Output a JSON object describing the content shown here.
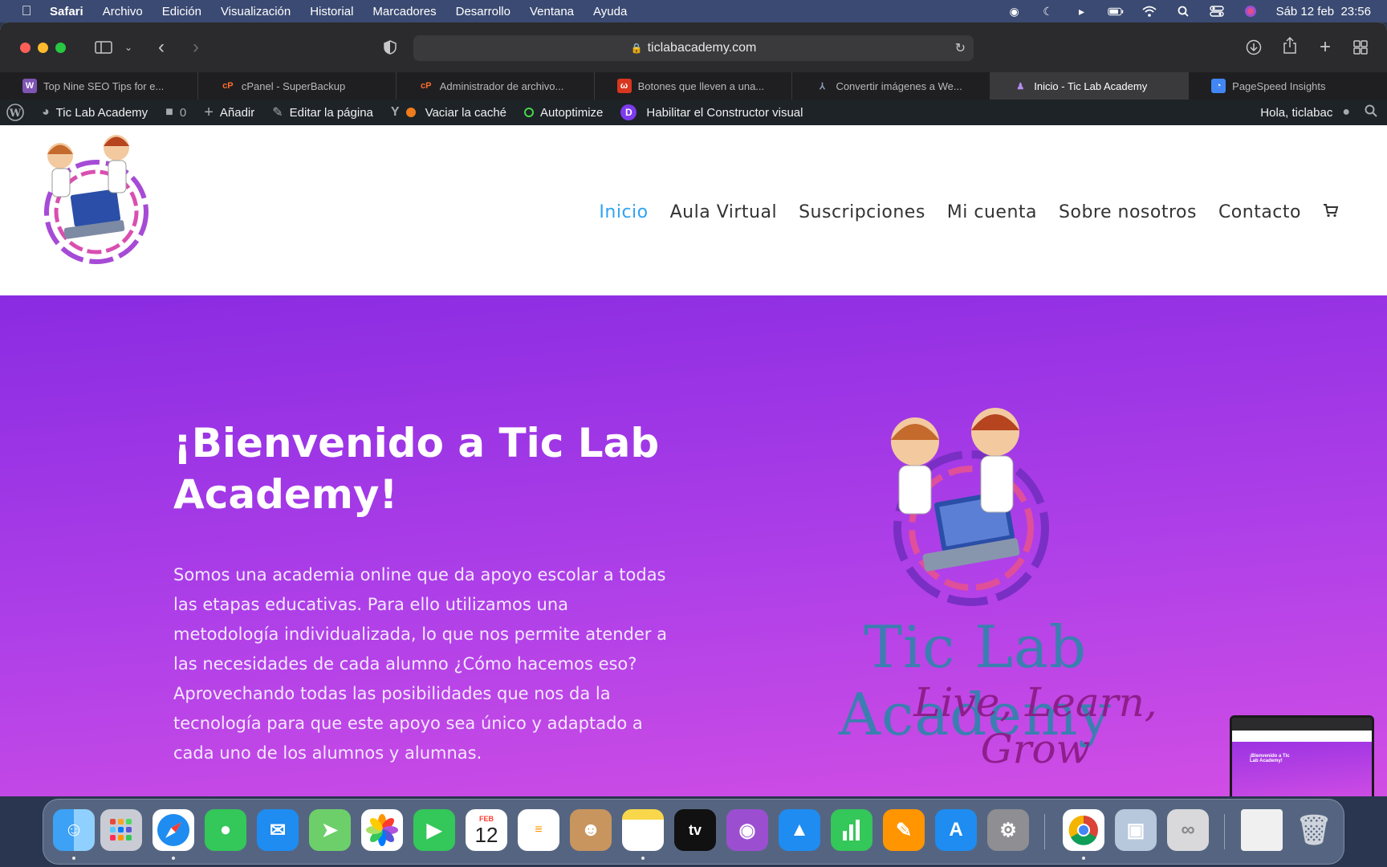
{
  "menubar": {
    "app_name": "Safari",
    "items": [
      "Archivo",
      "Edición",
      "Visualización",
      "Historial",
      "Marcadores",
      "Desarrollo",
      "Ventana",
      "Ayuda"
    ],
    "datetime": "Sáb 12 feb  23:56"
  },
  "browser": {
    "url": "ticlabacademy.com",
    "tabs": [
      {
        "label": "Top Nine SEO Tips for e...",
        "favicon": "W",
        "color": "#7f54b3"
      },
      {
        "label": "cPanel - SuperBackup",
        "favicon": "cP",
        "color": "#ff6c2c"
      },
      {
        "label": "Administrador de archivo...",
        "favicon": "cP",
        "color": "#ff6c2c"
      },
      {
        "label": "Botones que lleven a una...",
        "favicon": "ω",
        "color": "#d9361f"
      },
      {
        "label": "Convertir imágenes a We...",
        "favicon": "⅄",
        "color": "#4a5a7a"
      },
      {
        "label": "Inicio - Tic Lab Academy",
        "favicon": "♟",
        "color": "#7b3fbf",
        "active": true
      },
      {
        "label": "PageSpeed Insights",
        "favicon": "◔",
        "color": "#4285f4"
      }
    ]
  },
  "wp_admin_bar": {
    "site_name": "Tic Lab Academy",
    "comments_count": "0",
    "add_new": "Añadir",
    "edit_page": "Editar la página",
    "clear_cache": "Vaciar la caché",
    "autoptimize": "Autoptimize",
    "visual_builder": "Habilitar el Constructor visual",
    "greeting": "Hola, ticlabac"
  },
  "site": {
    "nav": [
      "Inicio",
      "Aula Virtual",
      "Suscripciones",
      "Mi cuenta",
      "Sobre nosotros",
      "Contacto"
    ],
    "active_nav": "Inicio",
    "hero_title": "¡Bienvenido a Tic Lab Academy!",
    "hero_text": "Somos una academia online que da apoyo escolar a todas las etapas educativas. Para ello utilizamos una metodología individualizada, lo que nos permite atender a las necesidades de cada alumno ¿Cómo hacemos eso? Aprovechando todas las posibilidades que nos da la tecnología para que este apoyo sea único y adaptado a cada uno de los alumnos y alumnas.",
    "brand_name": "Tic Lab Academy",
    "brand_tagline": "Live, Learn, Grow",
    "thumb_title": "¡Bienvenido a Tic Lab Academy!"
  },
  "dock": {
    "calendar_month": "FEB",
    "calendar_day": "12",
    "tv_label": "tv"
  },
  "colors": {
    "accent_nav": "#2ea3f2",
    "hero_gradient_start": "#8a2be2",
    "hero_gradient_end": "#d44fe4",
    "wp_bar": "#1d2327"
  }
}
